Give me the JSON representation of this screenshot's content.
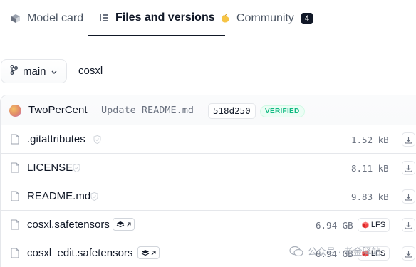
{
  "tabs": [
    {
      "label": "Model card",
      "icon": "cube-icon",
      "active": false
    },
    {
      "label": "Files and versions",
      "icon": "files-list-icon",
      "active": true
    },
    {
      "label": "Community",
      "icon": "hand-wave-icon",
      "active": false,
      "count": "4"
    }
  ],
  "branch": {
    "label": "main",
    "icon": "git-branch-icon"
  },
  "repo": {
    "name": "cosxl"
  },
  "commit": {
    "author": "TwoPerCent",
    "message": "Update README.md",
    "hash": "518d250",
    "status": "VERIFIED"
  },
  "files": [
    {
      "name": ".gitattributes",
      "size": "1.52 kB",
      "lfs": false,
      "pickle": false
    },
    {
      "name": "LICENSE",
      "size": "8.11 kB",
      "lfs": false,
      "pickle": false
    },
    {
      "name": "README.md",
      "size": "9.83 kB",
      "lfs": false,
      "pickle": false
    },
    {
      "name": "cosxl.safetensors",
      "size": "6.94 GB",
      "lfs": true,
      "pickle": true
    },
    {
      "name": "cosxl_edit.safetensors",
      "size": "6.94 GB",
      "lfs": true,
      "pickle": true
    }
  ],
  "lfs_label": "LFS",
  "watermark": {
    "text": "公众号 · 老金驿站"
  },
  "colors": {
    "verified": "#10b981",
    "lfs_icon": "#ef4444",
    "border": "#e5e7eb"
  }
}
